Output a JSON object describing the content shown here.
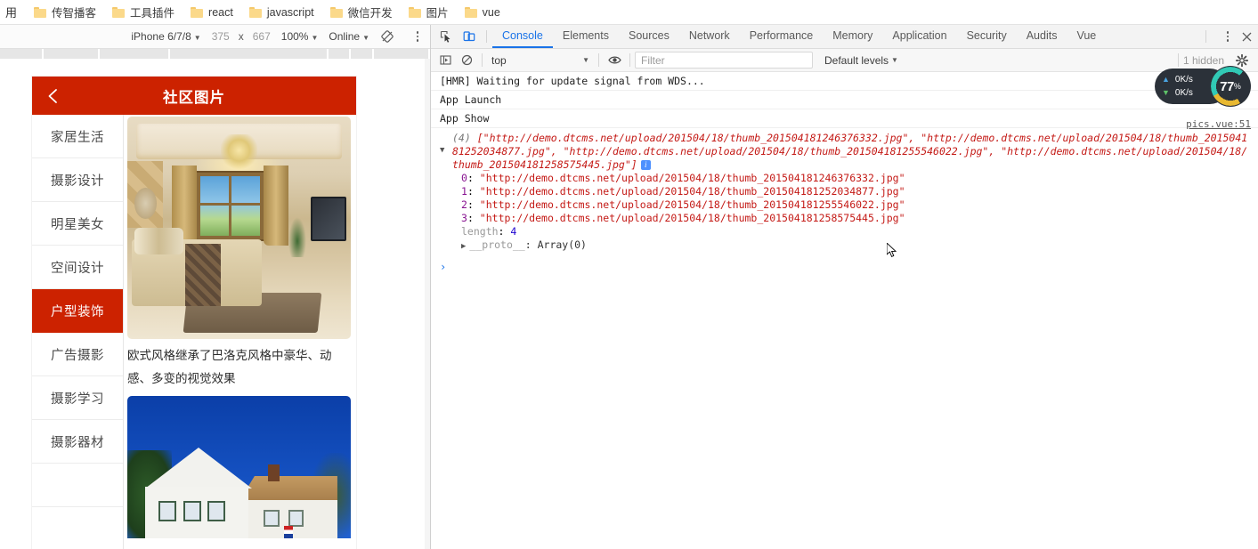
{
  "bookmarks": {
    "prefix_label": "用",
    "items": [
      {
        "label": "传智播客",
        "icon": "folder-icon"
      },
      {
        "label": "工具插件",
        "icon": "folder-icon"
      },
      {
        "label": "react",
        "icon": "folder-icon"
      },
      {
        "label": "javascript",
        "icon": "folder-icon"
      },
      {
        "label": "微信开发",
        "icon": "folder-icon"
      },
      {
        "label": "图片",
        "icon": "folder-icon"
      },
      {
        "label": "vue",
        "icon": "folder-icon"
      }
    ]
  },
  "device_toolbar": {
    "device_label": "iPhone 6/7/8",
    "width": "375",
    "x_label": "x",
    "height": "667",
    "zoom_label": "100%",
    "throttle_label": "Online",
    "rotate_icon": "rotate-icon",
    "more_icon": "kebab-menu-icon"
  },
  "phone": {
    "header": {
      "back_icon": "back-chevron-icon",
      "title": "社区图片"
    },
    "categories": [
      {
        "label": "家居生活",
        "active": false
      },
      {
        "label": "摄影设计",
        "active": false
      },
      {
        "label": "明星美女",
        "active": false
      },
      {
        "label": "空间设计",
        "active": false
      },
      {
        "label": "户型装饰",
        "active": true
      },
      {
        "label": "广告摄影",
        "active": false
      },
      {
        "label": "摄影学习",
        "active": false
      },
      {
        "label": "摄影器材",
        "active": false
      }
    ],
    "cards": [
      {
        "image_alt": "luxury-bedroom-photo",
        "caption": "欧式风格继承了巴洛克风格中豪华、动感、多变的视觉效果"
      },
      {
        "image_alt": "white-house-photo",
        "caption": ""
      }
    ],
    "accent_color": "#cc2200"
  },
  "devtools": {
    "inspect_icon": "inspect-element-icon",
    "device_toggle_icon": "device-toolbar-icon",
    "tabs": [
      {
        "label": "Console",
        "active": true
      },
      {
        "label": "Elements",
        "active": false
      },
      {
        "label": "Sources",
        "active": false
      },
      {
        "label": "Network",
        "active": false
      },
      {
        "label": "Performance",
        "active": false
      },
      {
        "label": "Memory",
        "active": false
      },
      {
        "label": "Application",
        "active": false
      },
      {
        "label": "Security",
        "active": false
      },
      {
        "label": "Audits",
        "active": false
      },
      {
        "label": "Vue",
        "active": false
      }
    ],
    "more_icon": "kebab-menu-icon",
    "close_icon": "close-icon",
    "active_tab_color": "#1a73e8",
    "console_toolbar": {
      "sidebar_icon": "console-sidebar-icon",
      "clear_icon": "clear-console-icon",
      "context_value": "top",
      "eye_icon": "live-expression-icon",
      "filter_placeholder": "Filter",
      "filter_value": "",
      "levels_value": "Default levels",
      "hidden_text": "1 hidden",
      "settings_icon": "gear-icon"
    },
    "console_logs": [
      {
        "text": "[HMR] Waiting for update signal from WDS..."
      },
      {
        "text": "App Launch"
      },
      {
        "text": "App Show"
      }
    ],
    "console_object": {
      "source_link": "pics.vue:51",
      "count_label": "(4)",
      "preview": "[\"http://demo.dtcms.net/upload/201504/18/thumb_201504181246376332.jpg\", \"http://demo.dtcms.net/upload/201504/18/thumb_201504181252034877.jpg\", \"http://demo.dtcms.net/upload/201504/18/thumb_201504181255546022.jpg\", \"http://demo.dtcms.net/upload/201504/18/thumb_201504181258575445.jpg\"]",
      "info_badge": "i",
      "entries": [
        {
          "index": "0",
          "value": "\"http://demo.dtcms.net/upload/201504/18/thumb_201504181246376332.jpg\""
        },
        {
          "index": "1",
          "value": "\"http://demo.dtcms.net/upload/201504/18/thumb_201504181252034877.jpg\""
        },
        {
          "index": "2",
          "value": "\"http://demo.dtcms.net/upload/201504/18/thumb_201504181255546022.jpg\""
        },
        {
          "index": "3",
          "value": "\"http://demo.dtcms.net/upload/201504/18/thumb_201504181258575445.jpg\""
        }
      ],
      "length_key": "length",
      "length_value": "4",
      "proto_key": "__proto__",
      "proto_value": "Array(0)"
    },
    "prompt_symbol": "›"
  },
  "net_widget": {
    "upload_speed": "0K/s",
    "download_speed": "0K/s",
    "gauge_value": "77",
    "gauge_unit": "%"
  }
}
